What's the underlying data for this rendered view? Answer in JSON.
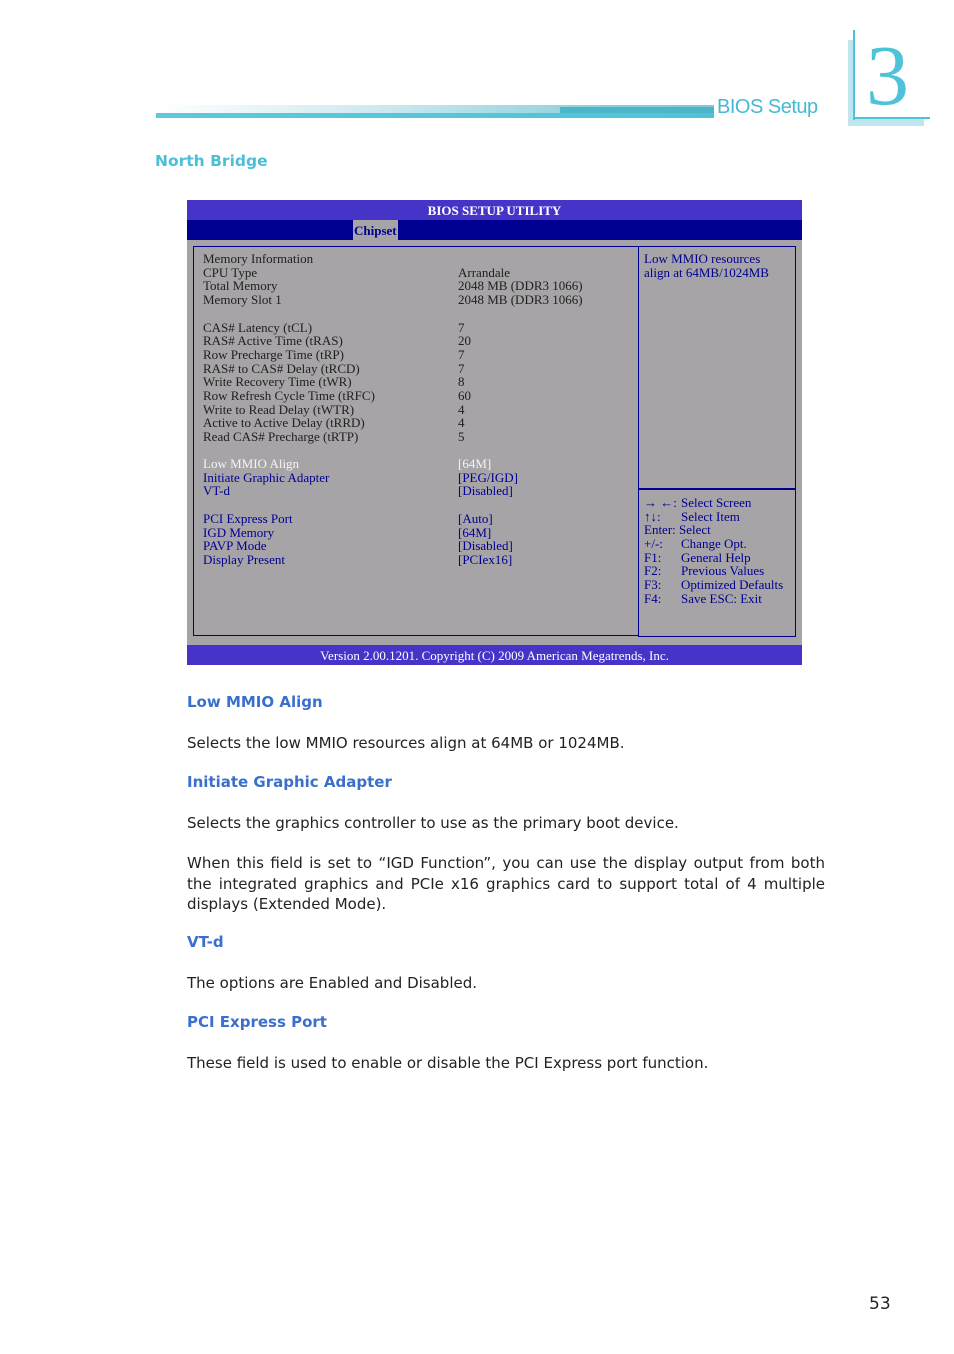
{
  "header": {
    "section_label": "BIOS Setup",
    "chapter_number": "3",
    "accent_color": "#4ec3d8"
  },
  "section_title": "North Bridge",
  "bios": {
    "title": "BIOS SETUP UTILITY",
    "active_tab": "Chipset",
    "colors": {
      "title_bar": "#4634c9",
      "tab_bar": "#000090",
      "panel": "#a6a4a6",
      "option_text": "#000090",
      "selected_text": "#f4f4f4"
    },
    "info_rows": [
      {
        "label": "Memory Information",
        "value": ""
      },
      {
        "label": "CPU Type",
        "value": "Arrandale"
      },
      {
        "label": "Total Memory",
        "value": "2048 MB (DDR3 1066)"
      },
      {
        "label": "Memory Slot 1",
        "value": "2048 MB (DDR3 1066)"
      }
    ],
    "timing_rows": [
      {
        "label": "CAS# Latency (tCL)",
        "value": "7"
      },
      {
        "label": "RAS# Active Time (tRAS)",
        "value": "20"
      },
      {
        "label": "Row Precharge Time (tRP)",
        "value": "7"
      },
      {
        "label": "RAS# to CAS# Delay (tRCD)",
        "value": "7"
      },
      {
        "label": "Write Recovery Time (tWR)",
        "value": "8"
      },
      {
        "label": "Row Refresh Cycle Time (tRFC)",
        "value": "60"
      },
      {
        "label": "Write to Read Delay (tWTR)",
        "value": "4"
      },
      {
        "label": "Active to Active Delay (tRRD)",
        "value": "4"
      },
      {
        "label": "Read CAS# Precharge (tRTP)",
        "value": "5"
      }
    ],
    "option_rows_1": [
      {
        "label": "Low MMIO Align",
        "value": "[64M]",
        "selected": true
      },
      {
        "label": "Initiate Graphic Adapter",
        "value": "[PEG/IGD]",
        "selected": false
      },
      {
        "label": "VT-d",
        "value": "[Disabled]",
        "selected": false
      }
    ],
    "option_rows_2": [
      {
        "label": "PCI Express Port",
        "value": "[Auto]"
      },
      {
        "label": "IGD Memory",
        "value": "[64M]"
      },
      {
        "label": "PAVP Mode",
        "value": "[Disabled]"
      },
      {
        "label": "Display Present",
        "value": "[PCIex16]"
      }
    ],
    "help_text_line1": "Low MMIO resources",
    "help_text_line2": "align at 64MB/1024MB",
    "keys": [
      {
        "key": "→ ←:",
        "desc": "Select Screen"
      },
      {
        "key": "↑↓:",
        "desc": "Select Item"
      },
      {
        "key": "Enter: Select",
        "desc": ""
      },
      {
        "key": "+/-:",
        "desc": "Change Opt."
      },
      {
        "key": "F1:",
        "desc": "General Help"
      },
      {
        "key": "F2:",
        "desc": "Previous Values"
      },
      {
        "key": "F3:",
        "desc": "Optimized Defaults"
      },
      {
        "key": "F4:",
        "desc": "Save   ESC: Exit"
      }
    ],
    "footer": "Version 2.00.1201. Copyright (C) 2009 American Megatrends, Inc."
  },
  "content": [
    {
      "heading": "Low MMIO Align",
      "paragraphs": [
        "Selects the low MMIO resources align at 64MB or 1024MB."
      ]
    },
    {
      "heading": "Initiate Graphic Adapter",
      "paragraphs": [
        "Selects the graphics controller to use as the primary boot device.",
        "When this field is set to “IGD Function”, you can use the display output from both the integrated graphics and PCIe x16 graphics card to support total of 4 multiple displays (Extended Mode)."
      ]
    },
    {
      "heading": "VT-d",
      "paragraphs": [
        "The options are Enabled and Disabled."
      ]
    },
    {
      "heading": "PCI Express Port",
      "paragraphs": [
        "These field is used to enable or disable the PCI Express port function."
      ]
    }
  ],
  "page_number": "53"
}
